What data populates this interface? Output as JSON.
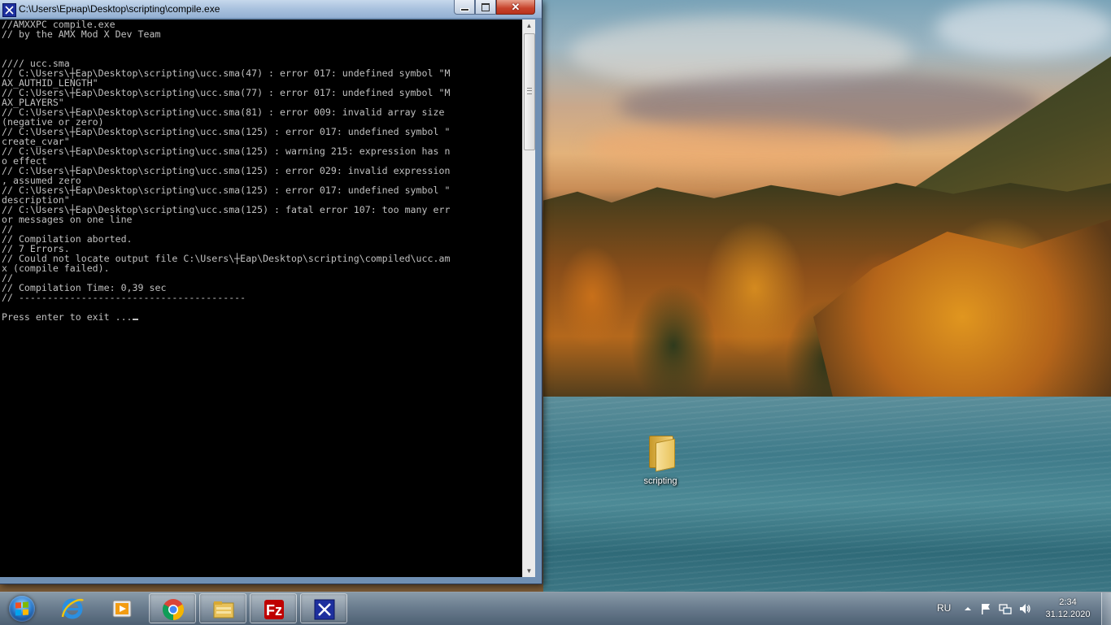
{
  "window": {
    "title": "C:\\Users\\Ернар\\Desktop\\scripting\\compile.exe",
    "close_glyph": "✕",
    "console_lines": [
      "//AMXXPC compile.exe",
      "// by the AMX Mod X Dev Team",
      "",
      "",
      "//// ucc.sma",
      "// C:\\Users\\┼Еар\\Desktop\\scripting\\ucc.sma(47) : error 017: undefined symbol \"M",
      "AX_AUTHID_LENGTH\"",
      "// C:\\Users\\┼Еар\\Desktop\\scripting\\ucc.sma(77) : error 017: undefined symbol \"M",
      "AX_PLAYERS\"",
      "// C:\\Users\\┼Еар\\Desktop\\scripting\\ucc.sma(81) : error 009: invalid array size",
      "(negative or zero)",
      "// C:\\Users\\┼Еар\\Desktop\\scripting\\ucc.sma(125) : error 017: undefined symbol \"",
      "create_cvar\"",
      "// C:\\Users\\┼Еар\\Desktop\\scripting\\ucc.sma(125) : warning 215: expression has n",
      "o effect",
      "// C:\\Users\\┼Еар\\Desktop\\scripting\\ucc.sma(125) : error 029: invalid expression",
      ", assumed zero",
      "// C:\\Users\\┼Еар\\Desktop\\scripting\\ucc.sma(125) : error 017: undefined symbol \"",
      "description\"",
      "// C:\\Users\\┼Еар\\Desktop\\scripting\\ucc.sma(125) : fatal error 107: too many err",
      "or messages on one line",
      "//",
      "// Compilation aborted.",
      "// 7 Errors.",
      "// Could not locate output file C:\\Users\\┼Еар\\Desktop\\scripting\\compiled\\ucc.am",
      "x (compile failed).",
      "//",
      "// Compilation Time: 0,39 sec",
      "// ----------------------------------------",
      "",
      "Press enter to exit ..."
    ]
  },
  "desktop": {
    "icons": [
      {
        "label": "scripting",
        "icon": "folder-icon"
      }
    ]
  },
  "taskbar": {
    "pinned": [
      {
        "name": "internet-explorer",
        "icon": "ie-icon",
        "active": false
      },
      {
        "name": "media-player",
        "icon": "media-player-icon",
        "active": false
      },
      {
        "name": "chrome",
        "icon": "chrome-icon",
        "active": true
      },
      {
        "name": "explorer",
        "icon": "explorer-folder-icon",
        "active": true
      },
      {
        "name": "filezilla",
        "icon": "filezilla-icon",
        "active": true
      },
      {
        "name": "compile",
        "icon": "compile-app-icon",
        "active": true
      }
    ],
    "language": "RU",
    "clock": {
      "time": "2:34",
      "date": "31.12.2020"
    }
  },
  "colors": {
    "console_bg": "#000000",
    "console_fg": "#c0c0c0",
    "title_bar": "#a8c1de",
    "close_button": "#c7432b"
  }
}
